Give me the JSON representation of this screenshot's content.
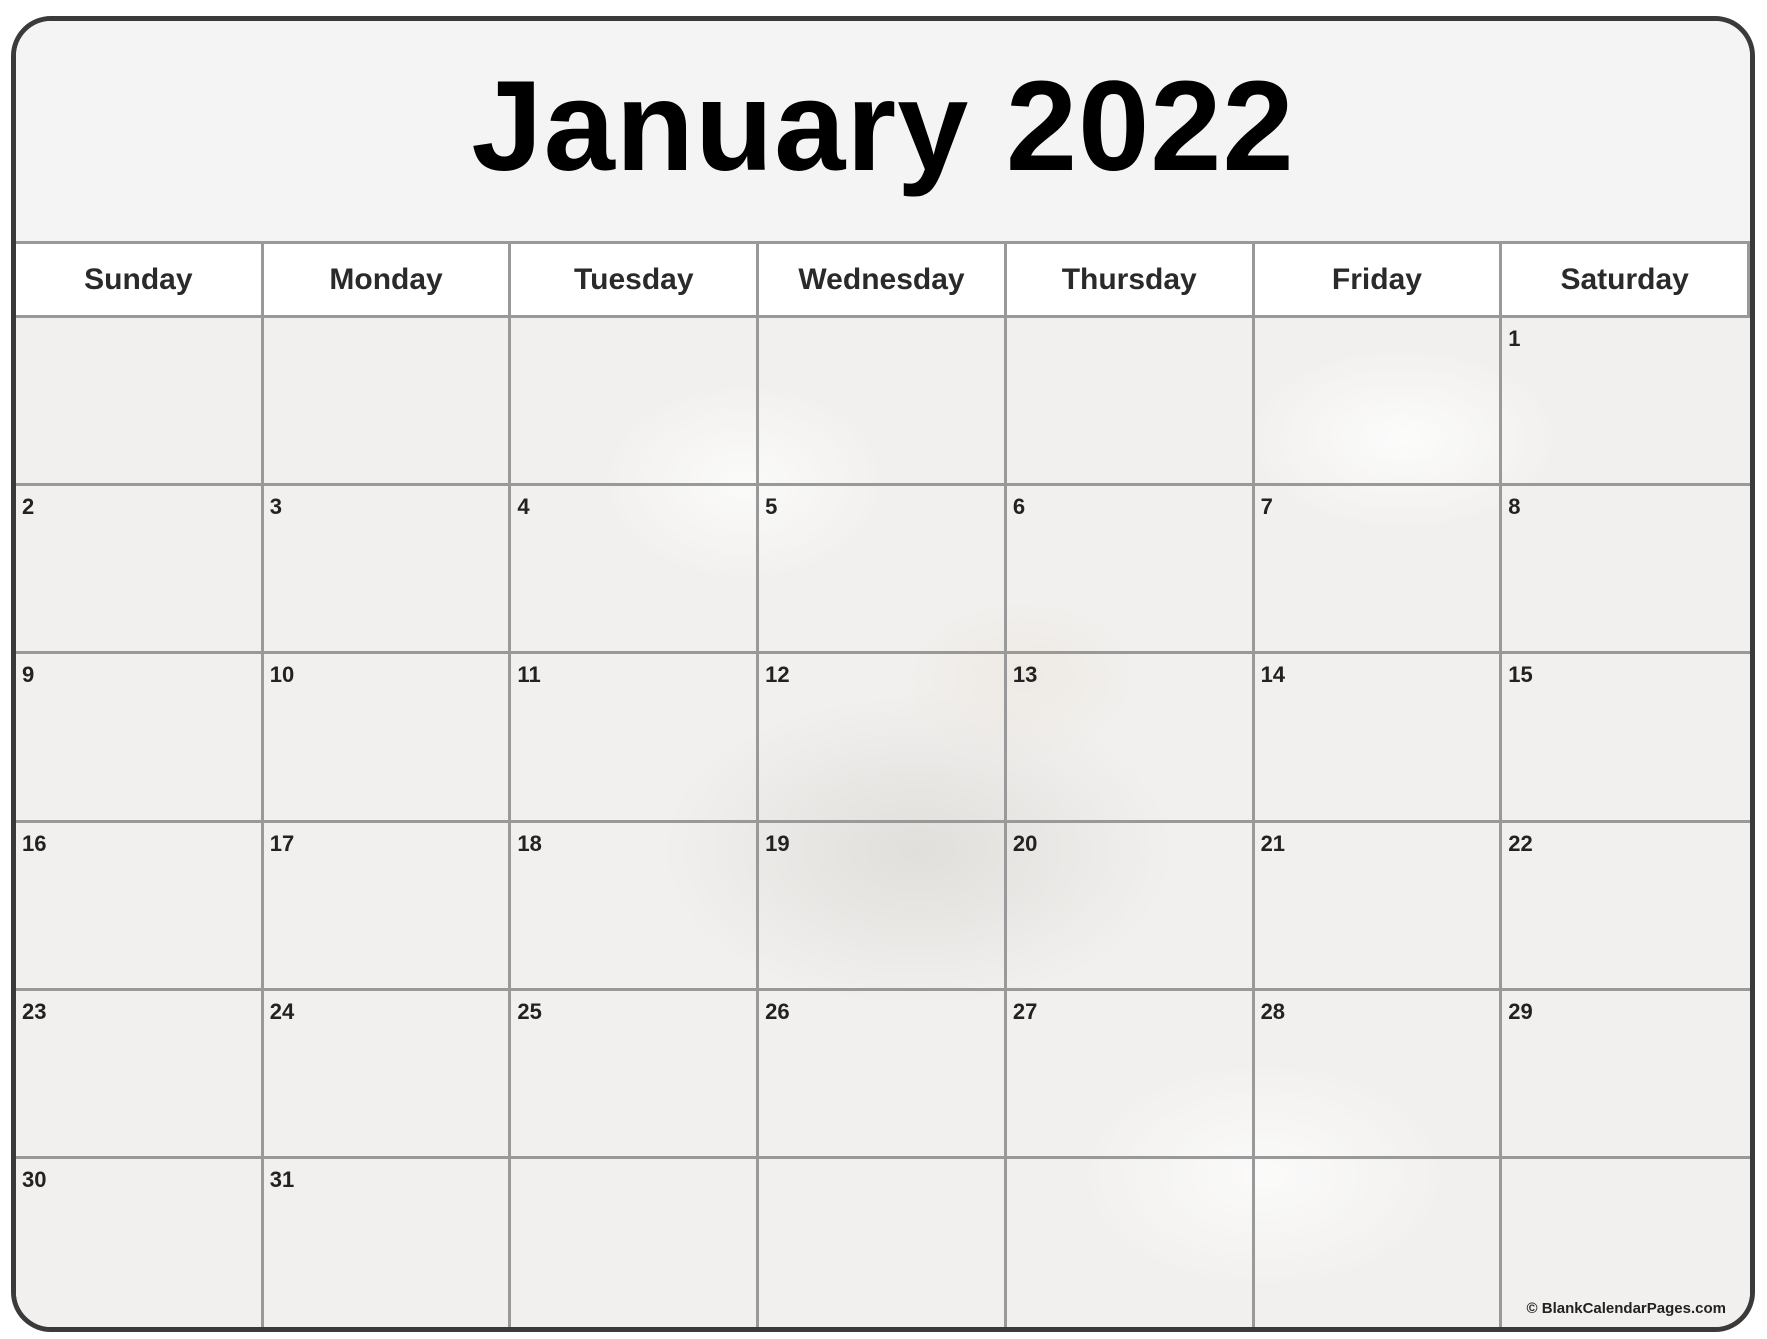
{
  "calendar": {
    "title": "January 2022",
    "weekdays": [
      "Sunday",
      "Monday",
      "Tuesday",
      "Wednesday",
      "Thursday",
      "Friday",
      "Saturday"
    ],
    "weeks": [
      [
        "",
        "",
        "",
        "",
        "",
        "",
        "1"
      ],
      [
        "2",
        "3",
        "4",
        "5",
        "6",
        "7",
        "8"
      ],
      [
        "9",
        "10",
        "11",
        "12",
        "13",
        "14",
        "15"
      ],
      [
        "16",
        "17",
        "18",
        "19",
        "20",
        "21",
        "22"
      ],
      [
        "23",
        "24",
        "25",
        "26",
        "27",
        "28",
        "29"
      ],
      [
        "30",
        "31",
        "",
        "",
        "",
        "",
        ""
      ]
    ],
    "credit": "© BlankCalendarPages.com",
    "background_image": "seashells-on-sand"
  }
}
